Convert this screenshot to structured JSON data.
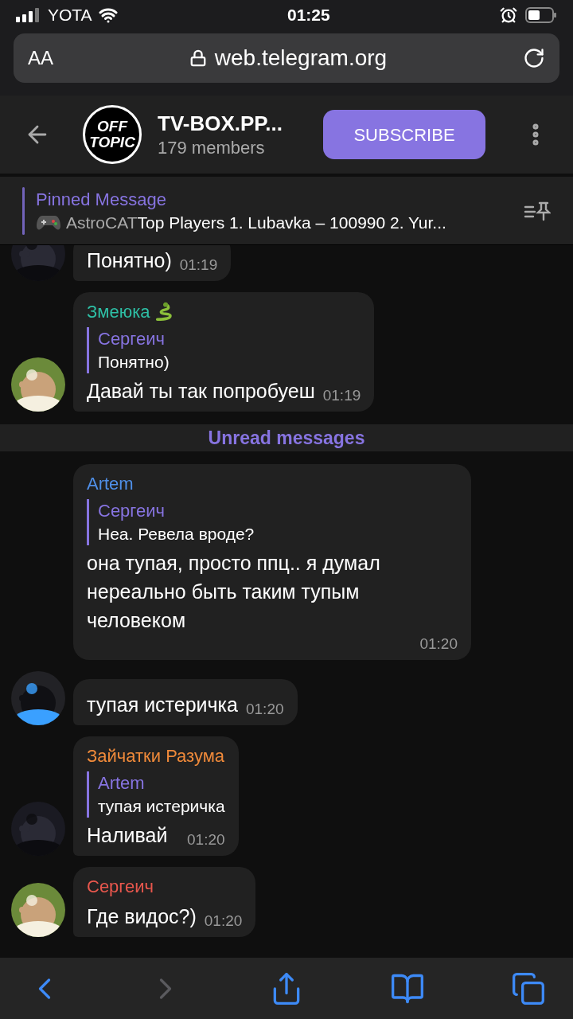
{
  "status_bar": {
    "carrier": "YOTA",
    "time": "01:25"
  },
  "address_bar": {
    "text_size": "AA",
    "url": "web.telegram.org"
  },
  "header": {
    "logo_lines": [
      "OFF",
      "TOPIC"
    ],
    "title": "TV-BOX.PP...",
    "subtitle": "179 members",
    "button": "SUBSCRIBE"
  },
  "pinned": {
    "label": "Pinned Message",
    "sender": "AstroCAT",
    "text": "Top Players 1. Lubavka – 100990 2. Yur..."
  },
  "messages": [
    {
      "kind": "message",
      "text": "Понятно)",
      "time": "01:19",
      "avatar": true
    },
    {
      "kind": "message",
      "sender": "Змеюка",
      "color": "#2ebfa5",
      "sender_emoji": true,
      "reply": {
        "name": "Сергеич",
        "text": "Понятно)"
      },
      "text": "Давай ты так попробуеш",
      "time": "01:19",
      "avatar": true
    },
    {
      "kind": "divider",
      "text": "Unread messages"
    },
    {
      "kind": "message",
      "sender": "Artem",
      "color": "#4f8fe8",
      "reply": {
        "name": "Сергеич",
        "text": "Неа. Ревела вроде?"
      },
      "text": "она тупая, просто ппц.. я думал нереально быть таким тупым человеком",
      "time": "01:20",
      "avatar": false
    },
    {
      "kind": "message",
      "text": "тупая истеричка",
      "time": "01:20",
      "avatar": true
    },
    {
      "kind": "message",
      "sender": "Зайчатки Разума",
      "color": "#f08a3a",
      "reply": {
        "name": "Artem",
        "text": "тупая истеричка"
      },
      "text": "Наливай",
      "time": "01:20",
      "avatar": true
    },
    {
      "kind": "message",
      "sender": "Сергеич",
      "color": "#e8574d",
      "text": "Где видос?)",
      "time": "01:20",
      "avatar": true
    }
  ],
  "toolbar": [
    {
      "kind": "back",
      "disabled": false
    },
    {
      "kind": "forward",
      "disabled": true
    },
    {
      "kind": "share",
      "disabled": false
    },
    {
      "kind": "bookmarks",
      "disabled": false
    },
    {
      "kind": "tabs",
      "disabled": false
    }
  ]
}
